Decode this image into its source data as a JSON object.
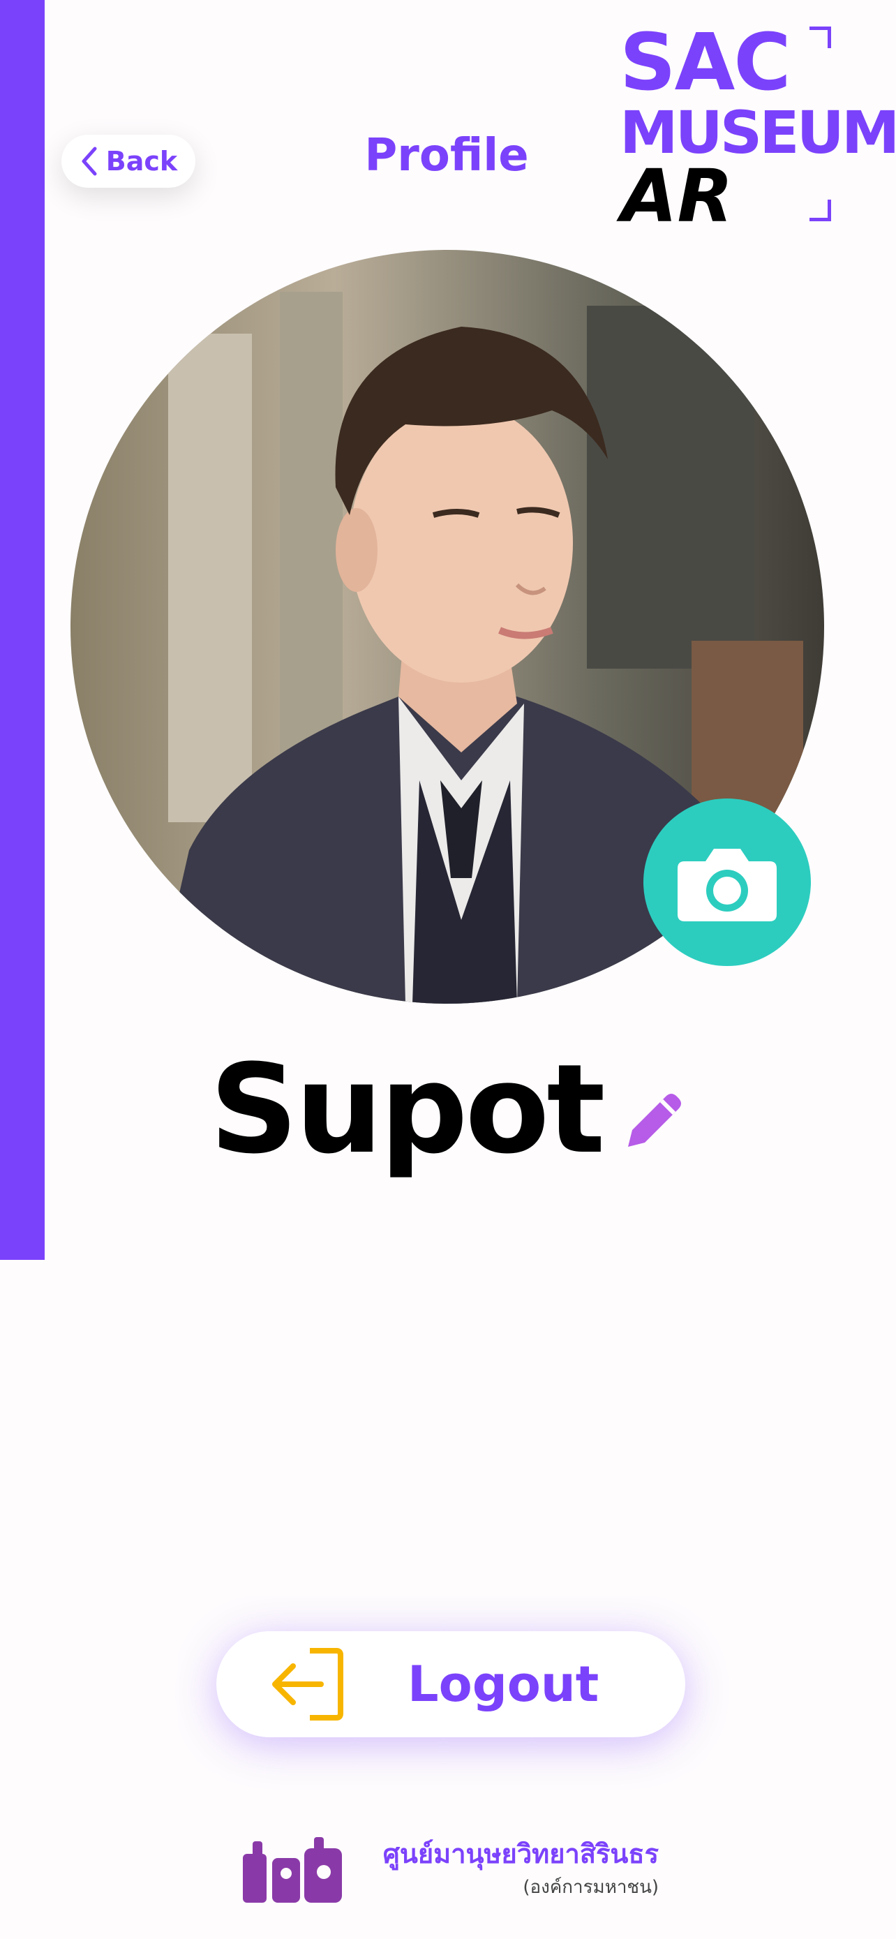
{
  "header": {
    "back_label": "Back",
    "title": "Profile",
    "logo": {
      "line1": "SAC",
      "line2": "MUSEUM",
      "line3": "AR"
    }
  },
  "profile": {
    "name": "Supot",
    "photo_icon": "camera-icon",
    "edit_icon": "pencil-icon"
  },
  "actions": {
    "logout_label": "Logout",
    "logout_icon": "logout-icon"
  },
  "footer": {
    "org_name": "ศูนย์มานุษยวิทยาสิรินธร",
    "org_subtitle": "(องค์การมหาชน)"
  },
  "colors": {
    "brand_purple": "#7b42fb",
    "camera_teal": "#2ccdbf",
    "logout_icon_orange": "#f7b500",
    "background": "#fefcfd"
  }
}
